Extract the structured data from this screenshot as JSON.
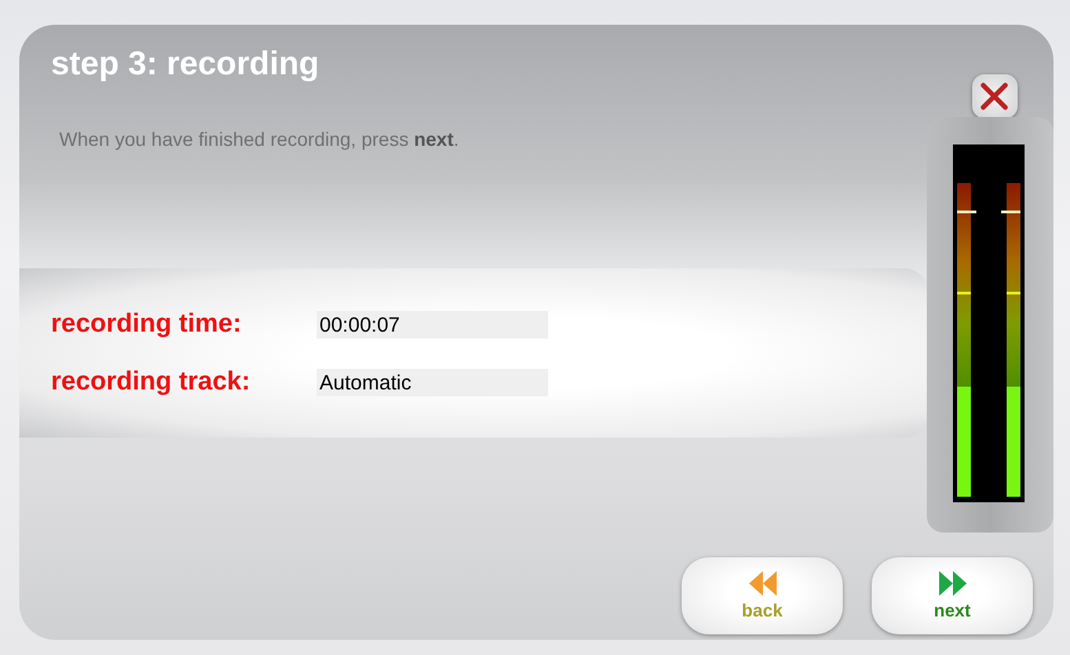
{
  "dialog": {
    "title": "step 3: recording",
    "instruction": "When you have finished recording, press **next**."
  },
  "fields": [
    {
      "label": "recording time:",
      "value": "00:00:07"
    },
    {
      "label": "recording track:",
      "value": "Automatic"
    }
  ],
  "meter": {
    "channels": [
      {
        "level": 0.35
      },
      {
        "level": 0.35
      }
    ]
  },
  "buttons": [
    {
      "kind": "back",
      "label": "back"
    },
    {
      "kind": "next",
      "label": "next"
    }
  ]
}
